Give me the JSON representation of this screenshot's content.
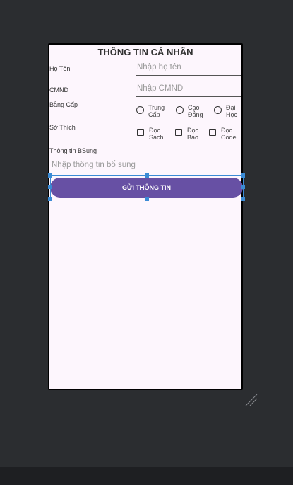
{
  "screen": {
    "title": "THÔNG TIN CÁ NHÂN",
    "ho_ten": {
      "label": "Họ Tên",
      "placeholder": "Nhập họ tên"
    },
    "cmnd": {
      "label": "CMND",
      "placeholder": "Nhập CMND"
    },
    "bang_cap": {
      "label": "Bằng Cấp",
      "options": [
        {
          "line1": "Trung",
          "line2": "Cấp"
        },
        {
          "line1": "Cao",
          "line2": "Đẳng"
        },
        {
          "line1": "Đại",
          "line2": "Học"
        }
      ]
    },
    "so_thich": {
      "label": "Sở Thích",
      "options": [
        {
          "line1": "Đọc",
          "line2": "Sách"
        },
        {
          "line1": "Đọc",
          "line2": "Báo"
        },
        {
          "line1": "Đọc",
          "line2": "Code"
        }
      ]
    },
    "bsung": {
      "label": "Thông tin BSung",
      "placeholder": "Nhập thông tin bổ sung"
    },
    "submit_label": "GỬI THÔNG TIN"
  },
  "colors": {
    "canvas_bg": "#2b2d30",
    "screen_bg": "#fdf6fd",
    "button_bg": "#6750a4",
    "selection": "#3b8bd5"
  }
}
